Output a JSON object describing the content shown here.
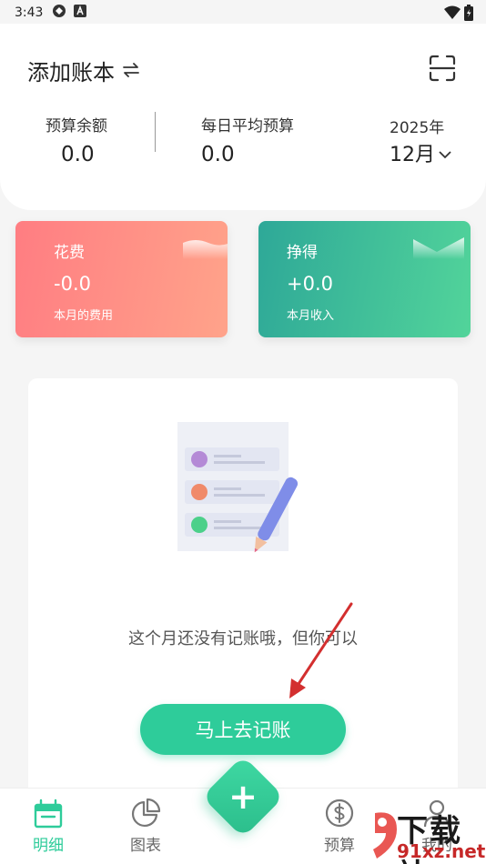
{
  "status_bar": {
    "time": "3:43",
    "icons": [
      "shield-icon",
      "a-letter-icon"
    ],
    "right_icons": [
      "wifi-icon",
      "battery-icon"
    ]
  },
  "header": {
    "book_title": "添加账本",
    "swap_icon": "swap-icon",
    "scan_icon": "scan-icon",
    "budget_label": "预算余额",
    "budget_value": "0.0",
    "daily_label": "每日平均预算",
    "daily_value": "0.0",
    "year": "2025年",
    "month": "12月",
    "month_chevron": "⌄"
  },
  "cards": {
    "expense": {
      "title": "花费",
      "value": "-0.0",
      "subtitle": "本月的费用",
      "color": "#ff7d82"
    },
    "income": {
      "title": "挣得",
      "value": "+0.0",
      "subtitle": "本月收入",
      "color": "#2ea898"
    }
  },
  "empty_state": {
    "message": "这个月还没有记账哦，但你可以",
    "button_label": "马上去记账"
  },
  "bottom_nav": {
    "items": [
      {
        "label": "明细",
        "icon": "calendar-box-icon",
        "active": true
      },
      {
        "label": "图表",
        "icon": "pie-chart-icon",
        "active": false
      },
      {
        "label": "预算",
        "icon": "money-circle-icon",
        "active": false
      },
      {
        "label": "我的",
        "icon": "person-icon",
        "active": false
      }
    ],
    "fab_label": "+"
  },
  "watermark": {
    "line1": "下载站",
    "line2": "91xz.net"
  },
  "colors": {
    "accent": "#2ecc9a",
    "expense": "#ff7d82",
    "income": "#2ea898",
    "annotation": "#d32f2f"
  }
}
